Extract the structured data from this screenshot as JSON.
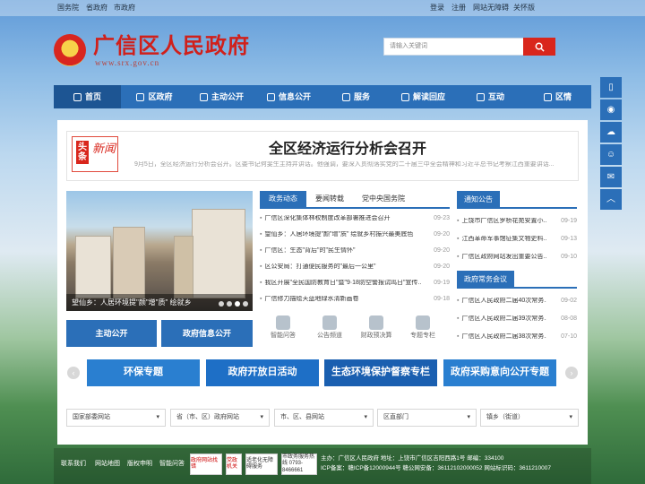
{
  "topbar": {
    "left": [
      "国务院",
      "省政府",
      "市政府"
    ],
    "right": [
      "登录",
      "注册",
      "网站无障碍",
      "关怀版"
    ]
  },
  "header": {
    "title": "广信区人民政府",
    "url": "www.srx.gov.cn",
    "search_placeholder": "请输入关键词"
  },
  "nav": [
    "首页",
    "区政府",
    "主动公开",
    "信息公开",
    "服务",
    "解读回应",
    "互动",
    "区情"
  ],
  "side_icons": [
    "mobile-icon",
    "weibo-icon",
    "wechat-icon",
    "robot-icon",
    "mail-icon",
    "up-arrow-icon"
  ],
  "headline": {
    "badge_a": "头条",
    "badge_b": "新闻",
    "title": "全区经济运行分析会召开",
    "summary": "9月5日，全区经济运行分析会召开。区委书记何斐生主持并讲话。他强调，要深入贯彻落实党的二十届三中全会精神和习近平总书记考察江西重要讲话..."
  },
  "slider": {
    "caption": "望仙乡：人居环境提\"颜\"增\"质\" 绘就乡",
    "dots": 4
  },
  "big_buttons": [
    "主动公开",
    "政府信息公开"
  ],
  "news": {
    "tabs": [
      "政务动态",
      "要闻转载",
      "党中央国务院"
    ],
    "items": [
      {
        "title": "广信区深化集体林权制度改革部署推进会召开",
        "date": "09-23"
      },
      {
        "title": "望仙乡：人居环境提\"颜\"增\"质\" 绘就乡村振兴最美底色",
        "date": "09-20"
      },
      {
        "title": "广信区：生态\"背后\"的\"民生情怀\"",
        "date": "09-20"
      },
      {
        "title": "区公安局：打通便民服务的\"最后一公里\"",
        "date": "09-20"
      },
      {
        "title": "我区开展\"全民国防教育日\"暨\"9·18防空警报试鸣日\"宣传...",
        "date": "09-19"
      },
      {
        "title": "广信修力描绘天蓝地绿水清新画卷",
        "date": "09-18"
      }
    ]
  },
  "quick_links": [
    "智能问答",
    "公告频道",
    "财政预决算",
    "专题专栏"
  ],
  "notice": {
    "heading": "通知公告",
    "items": [
      {
        "title": "上饶市广信区罗桥花苑安置小...",
        "date": "09-19"
      },
      {
        "title": "江西革命军事馆征集文物史料...",
        "date": "09-13"
      },
      {
        "title": "广信区政府网站发出重要公告...",
        "date": "09-10"
      }
    ]
  },
  "meeting": {
    "heading": "政府常务会议",
    "items": [
      {
        "title": "广信区人民政府二届40次常务...",
        "date": "09-02"
      },
      {
        "title": "广信区人民政府二届39次常务...",
        "date": "08-08"
      },
      {
        "title": "广信区人民政府二届38次常务...",
        "date": "07-10"
      }
    ]
  },
  "banners": [
    {
      "label": "环保专题",
      "color": "#2a7fd0"
    },
    {
      "label": "政府开放日活动",
      "color": "#1e6fc6"
    },
    {
      "label": "生态环境保护督察专栏",
      "color": "#1a5fb0"
    },
    {
      "label": "政府采购意向公开专题",
      "color": "#2a7fd0"
    }
  ],
  "selects": [
    "国家部委网站",
    "省（市、区）政府网站",
    "市、区、县网站",
    "区直部门",
    "镇乡（街道）"
  ],
  "footer": {
    "links": [
      "联系我们",
      "网站地图",
      "版权申明",
      "智能问答"
    ],
    "badges": [
      "政府网站找错",
      "党政机关",
      "适老化无障碍服务",
      "市政务服务热线 0793-8466661"
    ],
    "info1": "主办：广信区人民政府  地址：上饶市广信区吉阳西路1号  邮编：334100",
    "info2": "ICP备案：赣ICP备12000944号  赣公网安备：36112102000052  网站标识码：3611210007"
  }
}
